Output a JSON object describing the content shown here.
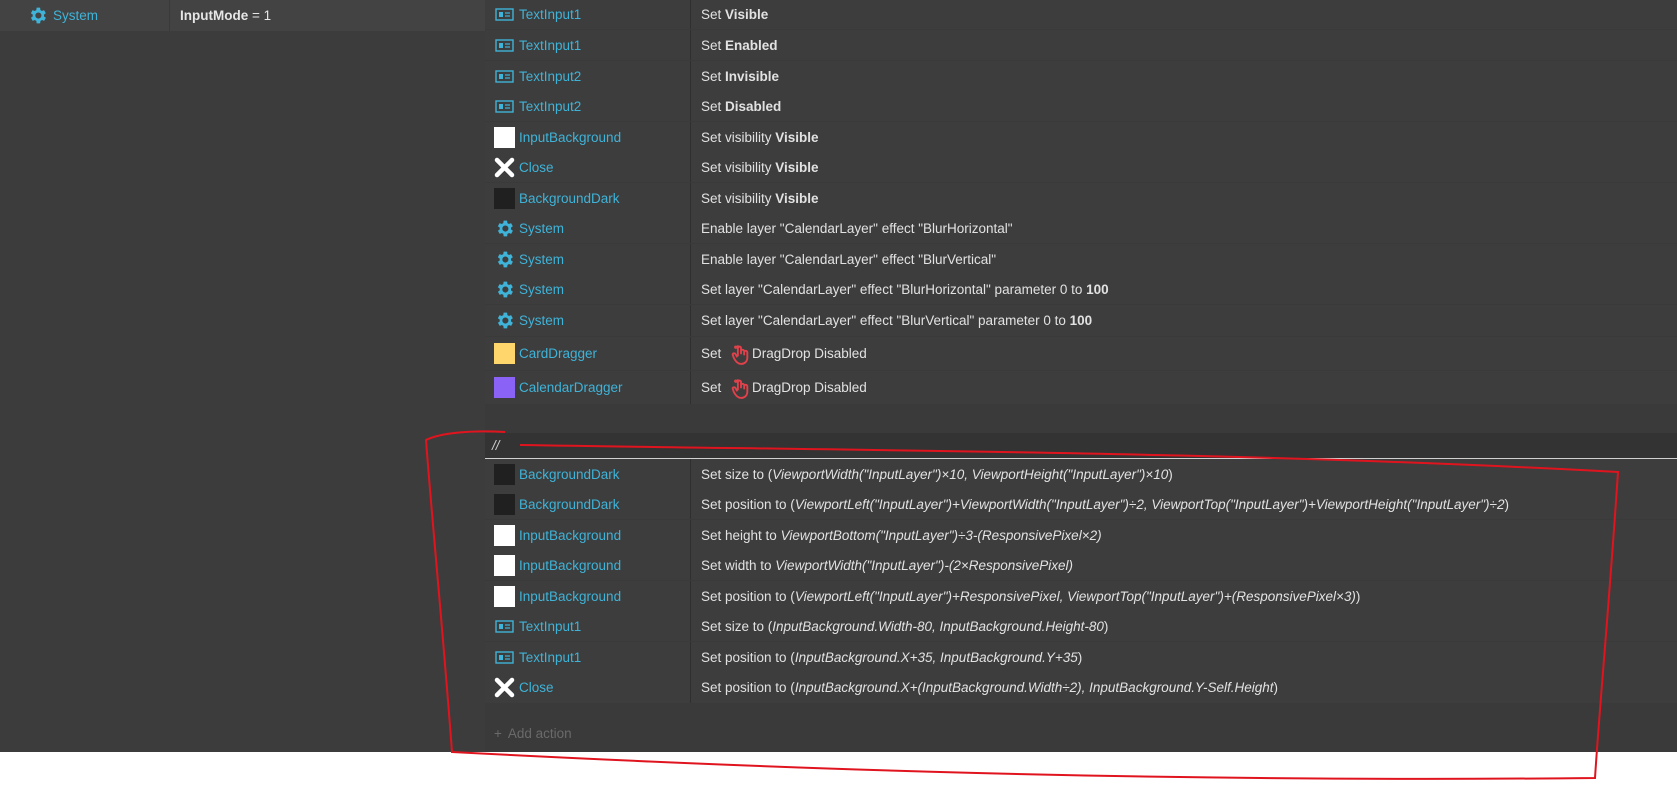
{
  "condition": {
    "object": "System",
    "variable": "InputMode",
    "operator": " = ",
    "value": "1"
  },
  "actions_top": [
    {
      "object": "TextInput1",
      "icon": "textinput",
      "parts": [
        {
          "t": "Set "
        },
        {
          "t": "Visible",
          "s": "b"
        }
      ]
    },
    {
      "object": "TextInput1",
      "icon": "textinput",
      "parts": [
        {
          "t": "Set "
        },
        {
          "t": "Enabled",
          "s": "b"
        }
      ]
    },
    {
      "object": "TextInput2",
      "icon": "textinput",
      "parts": [
        {
          "t": "Set "
        },
        {
          "t": "Invisible",
          "s": "b"
        }
      ]
    },
    {
      "object": "TextInput2",
      "icon": "textinput",
      "parts": [
        {
          "t": "Set "
        },
        {
          "t": "Disabled",
          "s": "b"
        }
      ]
    },
    {
      "object": "InputBackground",
      "icon": "white",
      "parts": [
        {
          "t": "Set visibility "
        },
        {
          "t": "Visible",
          "s": "b"
        }
      ]
    },
    {
      "object": "Close",
      "icon": "close",
      "parts": [
        {
          "t": "Set visibility "
        },
        {
          "t": "Visible",
          "s": "b"
        }
      ]
    },
    {
      "object": "BackgroundDark",
      "icon": "dark",
      "parts": [
        {
          "t": "Set visibility "
        },
        {
          "t": "Visible",
          "s": "b"
        }
      ]
    },
    {
      "object": "System",
      "icon": "gear",
      "parts": [
        {
          "t": "Enable layer \"CalendarLayer\" effect \"BlurHorizontal\""
        }
      ]
    },
    {
      "object": "System",
      "icon": "gear",
      "parts": [
        {
          "t": "Enable layer \"CalendarLayer\" effect \"BlurVertical\""
        }
      ]
    },
    {
      "object": "System",
      "icon": "gear",
      "parts": [
        {
          "t": "Set layer \"CalendarLayer\" effect \"BlurHorizontal\" parameter 0 to "
        },
        {
          "t": "100",
          "s": "b"
        }
      ]
    },
    {
      "object": "System",
      "icon": "gear",
      "parts": [
        {
          "t": "Set layer \"CalendarLayer\" effect \"BlurVertical\" parameter 0 to "
        },
        {
          "t": "100",
          "s": "b"
        }
      ]
    },
    {
      "object": "CardDragger",
      "icon": "yellow",
      "parts": [
        {
          "t": "Set "
        },
        {
          "t": "",
          "s": "drag"
        },
        {
          "t": "DragDrop Disabled"
        }
      ]
    },
    {
      "object": "CalendarDragger",
      "icon": "purple",
      "parts": [
        {
          "t": "Set "
        },
        {
          "t": "",
          "s": "drag"
        },
        {
          "t": "DragDrop Disabled"
        }
      ]
    }
  ],
  "comment": "//",
  "actions_bottom": [
    {
      "object": "BackgroundDark",
      "icon": "dark",
      "parts": [
        {
          "t": "Set size to ("
        },
        {
          "t": "ViewportWidth(\"InputLayer\")×10, ViewportHeight(\"InputLayer\")×10",
          "s": "i"
        },
        {
          "t": ")"
        }
      ]
    },
    {
      "object": "BackgroundDark",
      "icon": "dark",
      "parts": [
        {
          "t": "Set position to ("
        },
        {
          "t": "ViewportLeft(\"InputLayer\")+ViewportWidth(\"InputLayer\")÷2, ViewportTop(\"InputLayer\")+ViewportHeight(\"InputLayer\")÷2",
          "s": "i"
        },
        {
          "t": ")"
        }
      ]
    },
    {
      "object": "InputBackground",
      "icon": "white",
      "parts": [
        {
          "t": "Set height to "
        },
        {
          "t": "ViewportBottom(\"InputLayer\")÷3-(ResponsivePixel×2)",
          "s": "i"
        }
      ]
    },
    {
      "object": "InputBackground",
      "icon": "white",
      "parts": [
        {
          "t": "Set width to "
        },
        {
          "t": "ViewportWidth(\"InputLayer\")-(2×ResponsivePixel)",
          "s": "i"
        }
      ]
    },
    {
      "object": "InputBackground",
      "icon": "white",
      "parts": [
        {
          "t": "Set position to ("
        },
        {
          "t": "ViewportLeft(\"InputLayer\")+ResponsivePixel, ViewportTop(\"InputLayer\")+(ResponsivePixel×3)",
          "s": "i"
        },
        {
          "t": ")"
        }
      ]
    },
    {
      "object": "TextInput1",
      "icon": "textinput",
      "parts": [
        {
          "t": "Set size to ("
        },
        {
          "t": "InputBackground.Width-80, InputBackground.Height-80",
          "s": "i"
        },
        {
          "t": ")"
        }
      ]
    },
    {
      "object": "TextInput1",
      "icon": "textinput",
      "parts": [
        {
          "t": "Set position to ("
        },
        {
          "t": "InputBackground.X+35, InputBackground.Y+35",
          "s": "i"
        },
        {
          "t": ")"
        }
      ]
    },
    {
      "object": "Close",
      "icon": "close",
      "parts": [
        {
          "t": "Set position to ("
        },
        {
          "t": "InputBackground.X+(InputBackground.Width÷2), InputBackground.Y-Self.Height",
          "s": "i"
        },
        {
          "t": ")"
        }
      ]
    }
  ],
  "add_action": "Add action",
  "colors": {
    "object_link": "#3fb3d8",
    "annotation": "#e0141e",
    "card_dragger": "#ffd66b",
    "calendar_dragger": "#8a62f5"
  }
}
